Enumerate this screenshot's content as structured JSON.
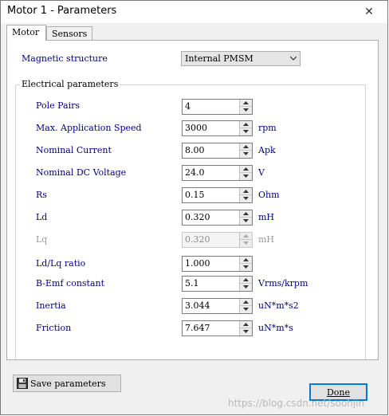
{
  "window": {
    "title": "Motor 1 - Parameters",
    "close_glyph": "✕"
  },
  "tabs": [
    {
      "label": "Motor",
      "active": true
    },
    {
      "label": "Sensors",
      "active": false
    }
  ],
  "magnetic": {
    "label": "Magnetic structure",
    "value": "Internal PMSM"
  },
  "electrical": {
    "group_title": "Electrical parameters",
    "params": [
      {
        "label": "Pole Pairs",
        "value": "4",
        "unit": "",
        "enabled": true
      },
      {
        "label": "Max. Application Speed",
        "value": "3000",
        "unit": "rpm",
        "enabled": true
      },
      {
        "label": "Nominal Current",
        "value": "8.00",
        "unit": "Apk",
        "enabled": true
      },
      {
        "label": "Nominal DC Voltage",
        "value": "24.0",
        "unit": "V",
        "enabled": true
      },
      {
        "label": "Rs",
        "value": "0.15",
        "unit": "Ohm",
        "enabled": true
      },
      {
        "label": "Ld",
        "value": "0.320",
        "unit": "mH",
        "enabled": true
      },
      {
        "label": "Lq",
        "value": "0.320",
        "unit": "mH",
        "enabled": false
      },
      {
        "label": "Ld/Lq ratio",
        "value": "1.000",
        "unit": "",
        "enabled": true
      },
      {
        "label": "B-Emf constant",
        "value": "5.1",
        "unit": "Vrms/krpm",
        "enabled": true
      },
      {
        "label": "Inertia",
        "value": "3.044",
        "unit": "uN*m*s2",
        "enabled": true
      },
      {
        "label": "Friction",
        "value": "7.647",
        "unit": "uN*m*s",
        "enabled": true
      }
    ]
  },
  "buttons": {
    "save": "Save parameters",
    "done": "Done"
  },
  "watermark": "https://blog.csdn.net/soohjin",
  "icons": {
    "close": "close-icon",
    "dropdown": "chevron-down-icon",
    "spin_up": "arrow-up-icon",
    "spin_down": "arrow-down-icon",
    "save": "floppy-disk-icon"
  },
  "colors": {
    "label_text": "#000080",
    "disabled_text": "#9a9a9a",
    "focus_border": "#0078d7"
  }
}
